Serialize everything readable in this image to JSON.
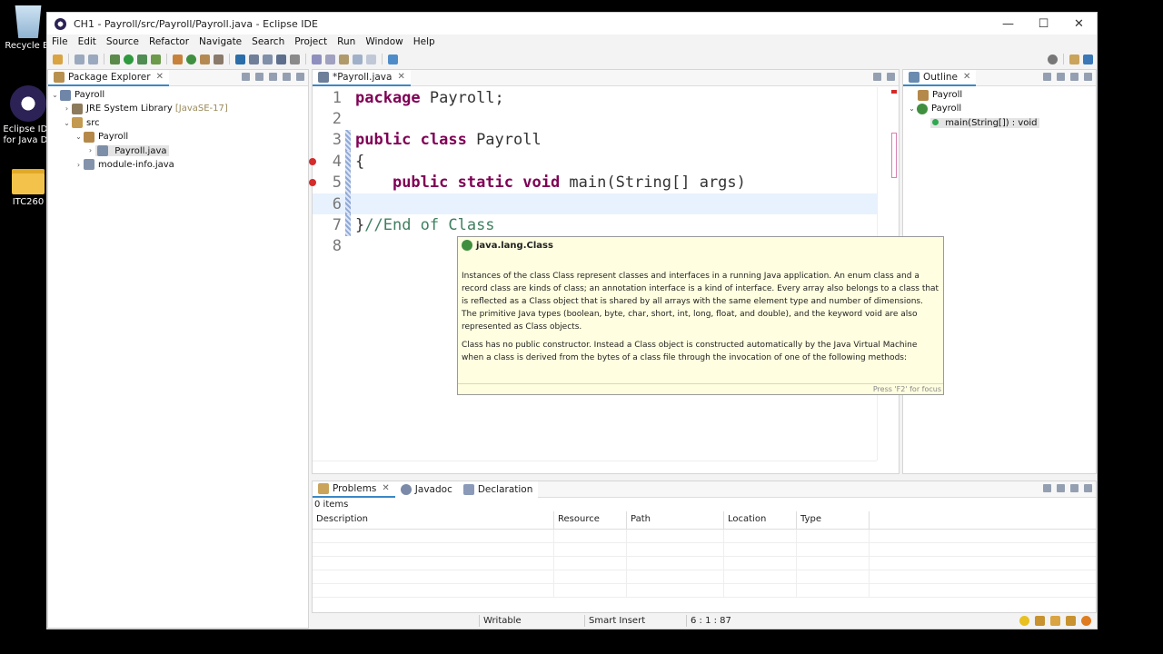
{
  "desktop": {
    "recycle_label": "Recycle Bi",
    "eclipse_label_1": "Eclipse IDE",
    "eclipse_label_2": "for Java De",
    "folder_label": "ITC260"
  },
  "window": {
    "title": "CH1 - Payroll/src/Payroll/Payroll.java - Eclipse IDE",
    "minimize": "—",
    "maximize": "☐",
    "close": "✕"
  },
  "menu": [
    "File",
    "Edit",
    "Source",
    "Refactor",
    "Navigate",
    "Search",
    "Project",
    "Run",
    "Window",
    "Help"
  ],
  "package_explorer": {
    "tab_label": "Package Explorer",
    "tree": {
      "project": "Payroll",
      "jre": "JRE System Library",
      "jre_version": "[JavaSE-17]",
      "src": "src",
      "package": "Payroll",
      "file": "Payroll.java",
      "module": "module-info.java"
    }
  },
  "editor": {
    "tab_label": "*Payroll.java",
    "lines": [
      {
        "n": "1",
        "kw": "package",
        "rest": " Payroll;"
      },
      {
        "n": "2",
        "kw": "",
        "rest": ""
      },
      {
        "n": "3",
        "kw": "public class",
        "rest": " Payroll"
      },
      {
        "n": "4",
        "kw": "",
        "rest": "{"
      },
      {
        "n": "5",
        "kw": "public static void",
        "rest": " main(String[] args)",
        "indent": "    "
      },
      {
        "n": "6",
        "kw": "",
        "rest": ""
      },
      {
        "n": "7",
        "kw": "",
        "rest": "}",
        "comment": "//End of Class"
      },
      {
        "n": "8",
        "kw": "",
        "rest": ""
      }
    ]
  },
  "hover": {
    "title": "java.lang.Class",
    "p1": "Instances of the class Class represent classes and interfaces in a running Java application. An enum class and a record class are kinds of class; an annotation interface is a kind of interface. Every array also belongs to a class that is reflected as a Class object that is shared by all arrays with the same element type and number of dimensions. The primitive Java types (boolean, byte, char, short, int, long, float, and double), and the keyword void are also represented as Class objects.",
    "p2": "Class has no public constructor. Instead a Class object is constructed automatically by the Java Virtual Machine when a class is derived from the bytes of a class file through the invocation of one of the following methods:",
    "footer": "Press 'F2' for focus"
  },
  "outline": {
    "tab_label": "Outline",
    "items": [
      "Payroll",
      "Payroll",
      "main(String[]) : void"
    ]
  },
  "problems": {
    "tabs": [
      "Problems",
      "Javadoc",
      "Declaration"
    ],
    "count": "0 items",
    "columns": [
      "Description",
      "Resource",
      "Path",
      "Location",
      "Type"
    ]
  },
  "statusbar": {
    "writable": "Writable",
    "insert_mode": "Smart Insert",
    "position": "6 : 1 : 87"
  }
}
